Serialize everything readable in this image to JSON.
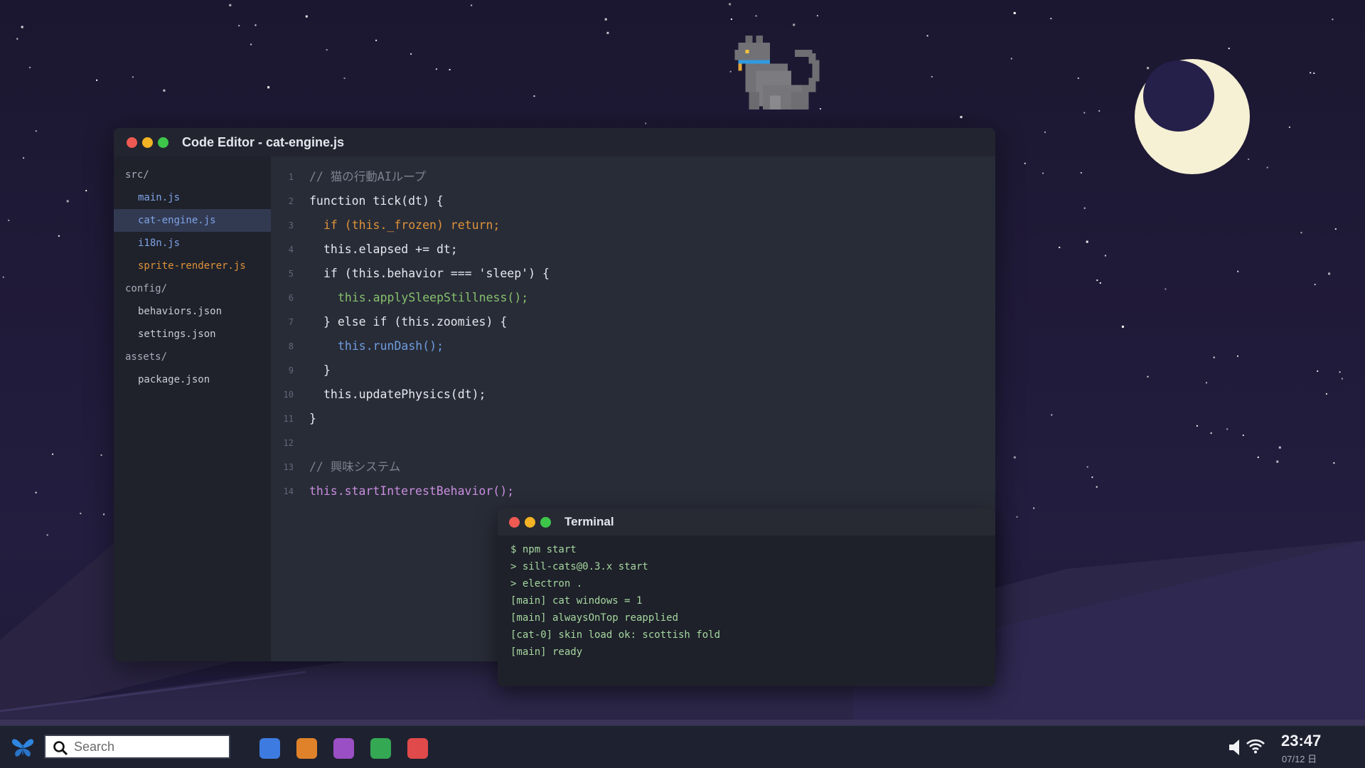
{
  "editor": {
    "title": "Code Editor - cat-engine.js",
    "tree": [
      {
        "type": "folder",
        "label": "src/"
      },
      {
        "type": "file",
        "label": "main.js",
        "color": "blue"
      },
      {
        "type": "file",
        "label": "cat-engine.js",
        "color": "blue",
        "selected": true
      },
      {
        "type": "file",
        "label": "i18n.js",
        "color": "blue"
      },
      {
        "type": "file",
        "label": "sprite-renderer.js",
        "color": "orange"
      },
      {
        "type": "folder",
        "label": "config/"
      },
      {
        "type": "file",
        "label": "behaviors.json",
        "color": "default"
      },
      {
        "type": "file",
        "label": "settings.json",
        "color": "default"
      },
      {
        "type": "folder",
        "label": "assets/"
      },
      {
        "type": "file",
        "label": "package.json",
        "color": "default"
      }
    ],
    "code_lines": [
      {
        "num": "1",
        "text": "// 猫の行動AIループ"
      },
      {
        "num": "2",
        "text": "function tick(dt) {"
      },
      {
        "num": "3",
        "text": "if (this._frozen) return;"
      },
      {
        "num": "4",
        "text": "this.elapsed += dt;"
      },
      {
        "num": "5",
        "text": "if (this.behavior === 'sleep') {"
      },
      {
        "num": "6",
        "text": "this.applySleepStillness();"
      },
      {
        "num": "7",
        "text": "} else if (this.zoomies) {"
      },
      {
        "num": "8",
        "text": "this.runDash();"
      },
      {
        "num": "9",
        "text": "}"
      },
      {
        "num": "10",
        "text": "this.updatePhysics(dt);"
      },
      {
        "num": "11",
        "text": "}"
      },
      {
        "num": "12",
        "text": ""
      },
      {
        "num": "13",
        "text": "// 興味システム"
      },
      {
        "num": "14",
        "text": "this.startInterestBehavior();"
      }
    ]
  },
  "terminal": {
    "title": "Terminal",
    "lines": [
      "$ npm start",
      "> sill-cats@0.3.x start",
      "> electron .",
      "[main] cat windows = 1",
      "[main] alwaysOnTop reapplied",
      "[cat-0] skin load ok: scottish fold",
      "[main] ready"
    ]
  },
  "taskbar": {
    "logo_icon": "butterfly-icon",
    "search_placeholder": "Search",
    "apps": [
      {
        "name": "app-blue",
        "color": "#3d7be0"
      },
      {
        "name": "app-orange",
        "color": "#e0822a"
      },
      {
        "name": "app-purple",
        "color": "#9b4fc4"
      },
      {
        "name": "app-green",
        "color": "#34a853"
      },
      {
        "name": "app-red",
        "color": "#e04a4a"
      }
    ],
    "clock_time": "23:47",
    "clock_date": "07/12 日"
  },
  "colors": {
    "accent_blue": "#7fa3e6",
    "accent_orange": "#e0923a",
    "terminal_text": "#a6d7a1",
    "moon": "#f6f0d4"
  }
}
